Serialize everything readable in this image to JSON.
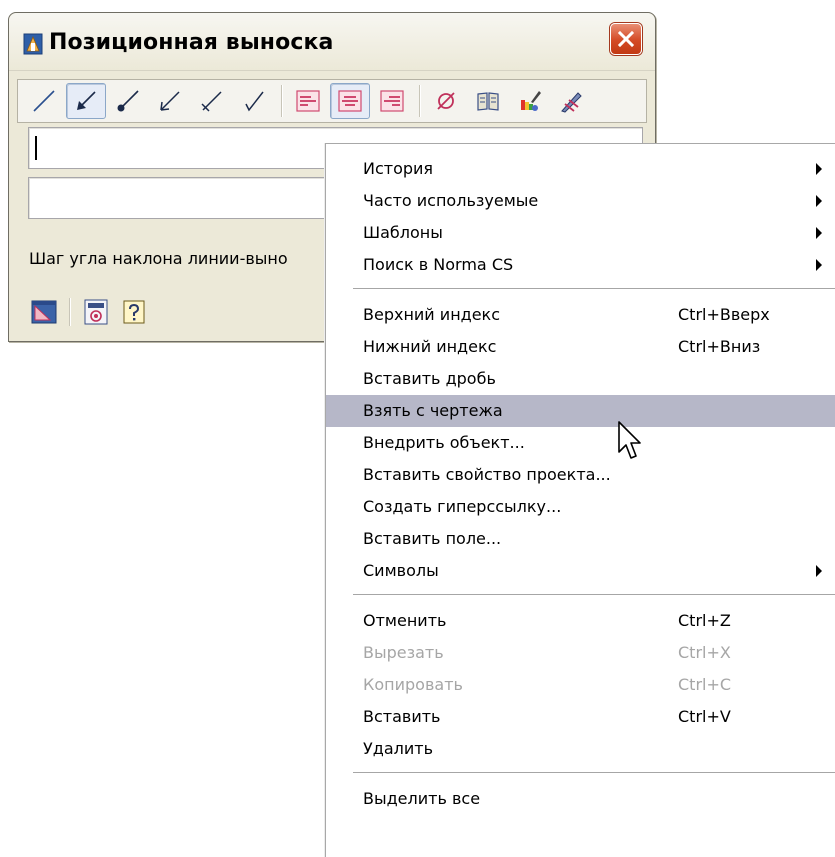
{
  "window": {
    "title": "Позиционная выноска",
    "angle_label": "Шаг угла наклона линии-выно",
    "field1_value": "",
    "field2_value": ""
  },
  "toolbar": {
    "icons": [
      "line-style-plain-icon",
      "line-style-arrow-icon",
      "line-style-dot-icon",
      "line-style-open-arrow-icon",
      "line-style-tick-icon",
      "line-style-check-icon",
      "align-left-icon",
      "align-center-icon",
      "align-right-icon",
      "diameter-icon",
      "book-icon",
      "paint-brush-icon",
      "pen-color-icon"
    ]
  },
  "bottom_tools": {
    "icons": [
      "drawing-settings-icon",
      "gost-standard-icon",
      "help-icon"
    ]
  },
  "context_menu": {
    "groups": [
      [
        {
          "label": "История",
          "submenu": true
        },
        {
          "label": "Часто используемые",
          "submenu": true
        },
        {
          "label": "Шаблоны",
          "submenu": true
        },
        {
          "label": "Поиск в Norma CS",
          "submenu": true
        }
      ],
      [
        {
          "label": "Верхний индекс",
          "shortcut": "Ctrl+Вверх"
        },
        {
          "label": "Нижний индекс",
          "shortcut": "Ctrl+Вниз"
        },
        {
          "label": "Вставить дробь"
        },
        {
          "label": "Взять с чертежа",
          "highlighted": true
        },
        {
          "label": "Внедрить объект..."
        },
        {
          "label": "Вставить свойство проекта..."
        },
        {
          "label": "Создать гиперссылку..."
        },
        {
          "label": "Вставить поле..."
        },
        {
          "label": "Символы",
          "submenu": true
        }
      ],
      [
        {
          "label": "Отменить",
          "shortcut": "Ctrl+Z"
        },
        {
          "label": "Вырезать",
          "shortcut": "Ctrl+X",
          "disabled": true
        },
        {
          "label": "Копировать",
          "shortcut": "Ctrl+C",
          "disabled": true
        },
        {
          "label": "Вставить",
          "shortcut": "Ctrl+V"
        },
        {
          "label": "Удалить"
        }
      ],
      [
        {
          "label": "Выделить все"
        }
      ]
    ]
  },
  "colors": {
    "dialog_bg": "#ece9d8",
    "menu_highlight": "#b6b7c8",
    "disabled_text": "#a6a6a6",
    "close_button": "#d44a25"
  }
}
